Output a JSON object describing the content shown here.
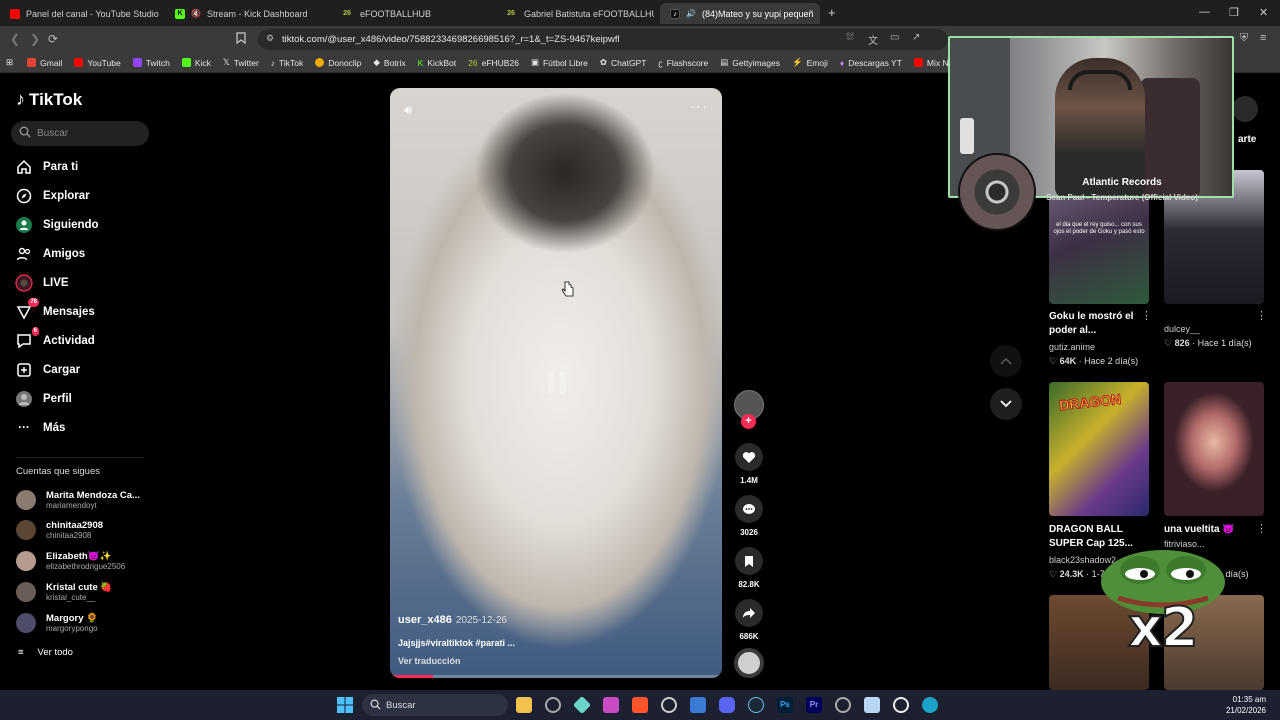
{
  "browser": {
    "tabs": [
      {
        "label": "Panel del canal - YouTube Studio",
        "favicon_color": "#ff0000",
        "active": false
      },
      {
        "label": "Stream - Kick Dashboard",
        "favicon_color": "#53fc18",
        "active": false
      },
      {
        "label": "eFOOTBALLHUB",
        "favicon_color": "#b8c43a",
        "favicon_text": "26",
        "active": false
      },
      {
        "label": "Gabriel Batistuta eFOOTBALLHUB Ju",
        "favicon_color": "#b8c43a",
        "favicon_text": "26",
        "active": false
      },
      {
        "label": "(84)Mateo y su yupi pequeñ",
        "favicon_color": "#111111",
        "active": true
      }
    ],
    "new_tab": "+",
    "url": "tiktok.com/@user_x486/video/7588233469826698516?_r=1&_t=ZS-9467keipwfl",
    "bookmarks": [
      {
        "label": "Gmail",
        "color": "#ea4335"
      },
      {
        "label": "YouTube",
        "color": "#ff0000"
      },
      {
        "label": "Twitch",
        "color": "#9146ff"
      },
      {
        "label": "Kick",
        "color": "#53fc18"
      },
      {
        "label": "Twitter",
        "color": "#ffffff"
      },
      {
        "label": "TikTok",
        "color": "#ffffff"
      },
      {
        "label": "Donoclip",
        "color": "#f2a900"
      },
      {
        "label": "Botrix",
        "color": "#dddddd"
      },
      {
        "label": "KickBot",
        "color": "#53fc18"
      },
      {
        "label": "eFHUB26",
        "color": "#b8c43a"
      },
      {
        "label": "Fútbol Libre",
        "color": "#dddddd"
      },
      {
        "label": "ChatGPT",
        "color": "#dddddd"
      },
      {
        "label": "Flashscore",
        "color": "#dddddd"
      },
      {
        "label": "Gettyimages",
        "color": "#dddddd"
      },
      {
        "label": "Emoji",
        "color": "#ff3b3b"
      },
      {
        "label": "Descargas YT",
        "color": "#b88cff"
      },
      {
        "label": "Mix N",
        "color": "#ff0000"
      }
    ]
  },
  "tiktok": {
    "logo": "TikTok",
    "search_placeholder": "Buscar",
    "nav": [
      {
        "label": "Para ti",
        "icon": "home-icon"
      },
      {
        "label": "Explorar",
        "icon": "compass-icon"
      },
      {
        "label": "Siguiendo",
        "icon": "following-icon"
      },
      {
        "label": "Amigos",
        "icon": "friends-icon"
      },
      {
        "label": "LIVE",
        "icon": "live-icon"
      },
      {
        "label": "Mensajes",
        "icon": "messages-icon",
        "badge": "78"
      },
      {
        "label": "Actividad",
        "icon": "activity-icon",
        "badge": "6"
      },
      {
        "label": "Cargar",
        "icon": "upload-icon"
      },
      {
        "label": "Perfil",
        "icon": "profile-icon"
      },
      {
        "label": "Más",
        "icon": "more-icon"
      }
    ],
    "following_title": "Cuentas que sigues",
    "following": [
      {
        "name": "Marita Mendoza Ca...",
        "handle": "mariamendoyt"
      },
      {
        "name": "chinitaa2908",
        "handle": "chinitaa2908"
      },
      {
        "name": "Elizabeth😈✨",
        "handle": "elizabethrodrigue2506"
      },
      {
        "name": "Kristal cute 🍓",
        "handle": "kristal_cute__"
      },
      {
        "name": "Margory 🌻",
        "handle": "margorypongo"
      }
    ],
    "see_all": "Ver todo",
    "video": {
      "author": "user_x486",
      "date": "2025-12-26",
      "caption": "Jajsjjs#viraltiktok #parati ...",
      "translate": "Ver traducción",
      "progress": 0.13
    },
    "actions": {
      "likes": "1.4M",
      "comments": "3026",
      "saves": "82.8K",
      "shares": "686K"
    },
    "recommendations": [
      {
        "title": "Goku le mostró el poder al...",
        "author": "gutiz.anime",
        "likes": "64K",
        "ago": "Hace 2 día(s)",
        "overlay_text": "el dia que el rey quiso... con sus ojos el poder de Goku y pasó esto"
      },
      {
        "title": "",
        "author": "dulcey__",
        "likes": "826",
        "ago": "Hace 1 día(s)"
      },
      {
        "title": "DRAGON BALL SUPER Cap 125...",
        "author": "black23shadow2",
        "likes": "24.3K",
        "ago": "1-7"
      },
      {
        "title": "una vueltita 😈",
        "author": "fitriviaso...",
        "likes": "",
        "ago": "1 día(s)"
      }
    ],
    "partial_tab": "arte"
  },
  "overlay": {
    "now_playing_artist": "Atlantic Records",
    "now_playing_track": "Sean Paul - Temperature (Official Video)",
    "sticker_text": "x2"
  },
  "taskbar": {
    "search_placeholder": "Buscar",
    "time": "01:35 am",
    "date": "21/02/2026"
  }
}
